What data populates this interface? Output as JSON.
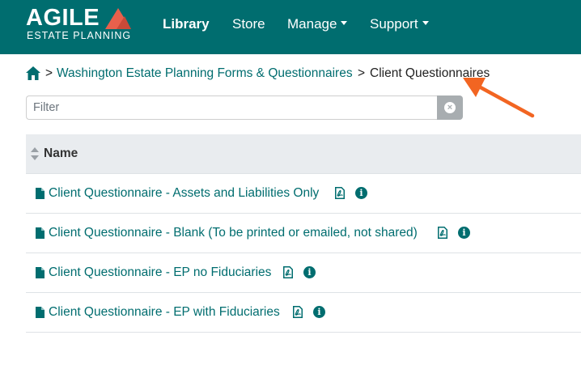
{
  "brand": {
    "name": "AGILE",
    "tagline": "ESTATE PLANNING",
    "primary_color": "#006d6f",
    "accent_color": "#e8604c"
  },
  "nav": {
    "library": "Library",
    "store": "Store",
    "manage": "Manage",
    "support": "Support"
  },
  "breadcrumb": {
    "home_icon": "home-icon",
    "separator": ">",
    "parent": "Washington Estate Planning Forms & Questionnaires",
    "current": "Client Questionnaires"
  },
  "filter": {
    "placeholder": "Filter",
    "value": "",
    "clear_icon": "times-circle-icon"
  },
  "table": {
    "column_header": "Name",
    "rows": [
      {
        "name": "Client Questionnaire - Assets and Liabilities Only"
      },
      {
        "name": "Client Questionnaire - Blank (To be printed or emailed, not shared)"
      },
      {
        "name": "Client Questionnaire - EP no Fiduciaries"
      },
      {
        "name": "Client Questionnaire - EP with Fiduciaries"
      }
    ]
  }
}
